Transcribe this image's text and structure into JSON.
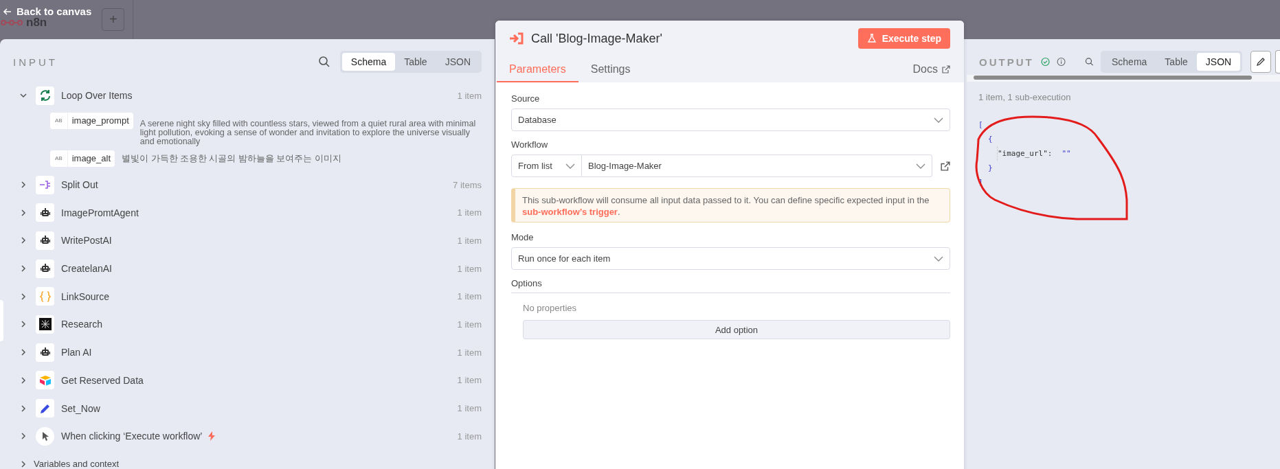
{
  "topbar": {
    "logo_text": "n8n",
    "back_label": "Back to canvas",
    "add_label": "+"
  },
  "input_panel": {
    "title": "INPUT",
    "view_tabs": [
      {
        "label": "Schema",
        "selected": true
      },
      {
        "label": "Table",
        "selected": false
      },
      {
        "label": "JSON",
        "selected": false
      }
    ],
    "nodes": [
      {
        "kind": "loop",
        "name": "Loop Over Items",
        "count": "1 item",
        "expanded": true,
        "fields": [
          {
            "type_badge": "AB",
            "name": "image_prompt",
            "value": "A serene night sky filled with countless stars, viewed from a quiet rural area with minimal light pollution, evoking a sense of wonder and invitation to explore the universe visually and emotionally"
          },
          {
            "type_badge": "AB",
            "name": "image_alt",
            "value": "별빛이 가득한 조용한 시골의 밤하늘을 보여주는 이미지"
          }
        ]
      },
      {
        "kind": "split",
        "name": "Split Out",
        "count": "7 items",
        "expanded": false
      },
      {
        "kind": "robot",
        "name": "ImagePromtAgent",
        "count": "1 item",
        "expanded": false
      },
      {
        "kind": "robot",
        "name": "WritePostAI",
        "count": "1 item",
        "expanded": false
      },
      {
        "kind": "robot",
        "name": "CreatelanAI",
        "count": "1 item",
        "expanded": false
      },
      {
        "kind": "braces",
        "name": "LinkSource",
        "count": "1 item",
        "expanded": false
      },
      {
        "kind": "research",
        "name": "Research",
        "count": "1 item",
        "expanded": false
      },
      {
        "kind": "robot",
        "name": "Plan AI",
        "count": "1 item",
        "expanded": false
      },
      {
        "kind": "airtable",
        "name": "Get Reserved Data",
        "count": "1 item",
        "expanded": false
      },
      {
        "kind": "pencil",
        "name": "Set_Now",
        "count": "1 item",
        "expanded": false
      },
      {
        "kind": "cursor",
        "name": "When clicking ‘Execute workflow’",
        "count": "1 item",
        "expanded": false,
        "trigger": true
      }
    ],
    "footer_label": "Variables and context"
  },
  "node_panel": {
    "title": "Call 'Blog-Image-Maker'",
    "execute_label": "Execute step",
    "tabs": [
      {
        "label": "Parameters",
        "selected": true
      },
      {
        "label": "Settings",
        "selected": false
      }
    ],
    "docs_label": "Docs",
    "source": {
      "label": "Source",
      "value": "Database"
    },
    "workflow": {
      "label": "Workflow",
      "mode_value": "From list",
      "value": "Blog-Image-Maker"
    },
    "notice": {
      "text": "This sub-workflow will consume all input data passed to it. You can define specific expected input in the ",
      "link": "sub-workflow’s trigger",
      "text_end": "."
    },
    "mode": {
      "label": "Mode",
      "value": "Run once for each item"
    },
    "options": {
      "label": "Options",
      "empty_text": "No properties",
      "add_label": "Add option"
    }
  },
  "output_panel": {
    "title": "OUTPUT",
    "view_tabs": [
      {
        "label": "Schema",
        "selected": false
      },
      {
        "label": "Table",
        "selected": false
      },
      {
        "label": "JSON",
        "selected": true
      }
    ],
    "summary": "1 item, 1 sub-execution",
    "json": {
      "open": "[",
      "close": "]",
      "item": {
        "open": "{",
        "close": "}",
        "key": "\"image_url\":",
        "value": "\"\""
      }
    }
  }
}
